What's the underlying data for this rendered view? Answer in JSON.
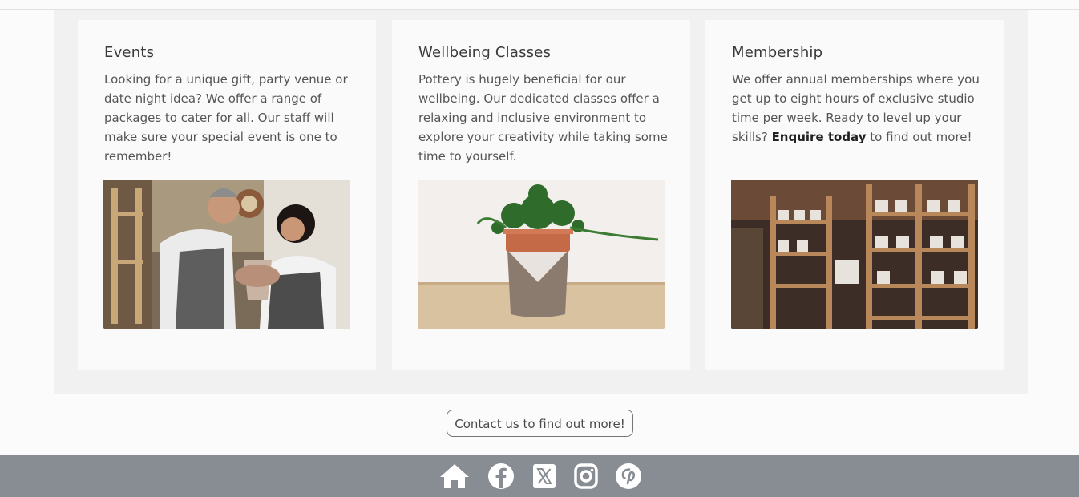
{
  "cards": [
    {
      "title": "Events",
      "body": "Looking for a unique gift, party venue or date night idea? We offer a range of packages to cater for all. Our staff will make sure your special event is one to remember!",
      "image_alt": "Potter and woman shaping clay together"
    },
    {
      "title": "Wellbeing Classes",
      "body": "Pottery is hugely beneficial for our wellbeing. Our dedicated classes offer a relaxing and inclusive environment to explore your creativity while taking some time to yourself.",
      "image_alt": "Trailing plant in a hand-thrown pot"
    },
    {
      "title": "Membership",
      "body_before": "We offer annual memberships where you get up to eight hours of exclusive studio time per week. Ready to level up your skills? ",
      "link_text": "Enquire today",
      "body_after": " to find out more!",
      "image_alt": "Shelves of ceramics in a pottery studio"
    }
  ],
  "cta": {
    "label": "Contact us to find out more!"
  },
  "footer": {
    "icons": [
      "home-icon",
      "facebook-icon",
      "x-icon",
      "instagram-icon",
      "pinterest-icon"
    ],
    "icon_color": "#ffffff",
    "background": "#878d93"
  }
}
